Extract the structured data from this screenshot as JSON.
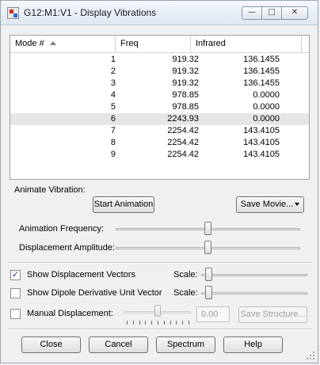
{
  "window": {
    "title": "G12:M1:V1 - Display Vibrations",
    "minimize_glyph": "—",
    "maximize_glyph": "□",
    "close_glyph": "✕"
  },
  "table": {
    "columns": [
      "Mode #",
      "Freq",
      "Infrared"
    ],
    "rows": [
      {
        "mode": "1",
        "freq": "919.32",
        "ir": "136.1455"
      },
      {
        "mode": "2",
        "freq": "919.32",
        "ir": "136.1455"
      },
      {
        "mode": "3",
        "freq": "919.32",
        "ir": "136.1455"
      },
      {
        "mode": "4",
        "freq": "978.85",
        "ir": "0.0000"
      },
      {
        "mode": "5",
        "freq": "978.85",
        "ir": "0.0000"
      },
      {
        "mode": "6",
        "freq": "2243.93",
        "ir": "0.0000"
      },
      {
        "mode": "7",
        "freq": "2254.42",
        "ir": "143.4105"
      },
      {
        "mode": "8",
        "freq": "2254.42",
        "ir": "143.4105"
      },
      {
        "mode": "9",
        "freq": "2254.42",
        "ir": "143.4105"
      }
    ],
    "selected_row": 6
  },
  "animate": {
    "label": "Animate Vibration:",
    "start_button": "Start Animation",
    "save_movie_button": "Save Movie...",
    "frequency_label": "Animation Frequency:",
    "amplitude_label": "Displacement Amplitude:",
    "frequency_value": 0.5,
    "amplitude_value": 0.5
  },
  "options": {
    "show_displacement_vectors": {
      "label": "Show Displacement Vectors",
      "checked": true,
      "scale_label": "Scale:",
      "scale_value": 0.07
    },
    "show_dipole_vector": {
      "label": "Show Dipole Derivative Unit Vector",
      "checked": false,
      "scale_label": "Scale:",
      "scale_value": 0.07
    },
    "manual_displacement": {
      "label": "Manual Displacement:",
      "checked": false,
      "value_text": "0.00",
      "slider_value": 0.5,
      "save_structure_button": "Save Structure..."
    }
  },
  "footer": {
    "close": "Close",
    "cancel": "Cancel",
    "spectrum": "Spectrum",
    "help": "Help"
  },
  "colors": {
    "selected_row": "#e6e6e6",
    "window_bg": "#f0f0f0"
  }
}
